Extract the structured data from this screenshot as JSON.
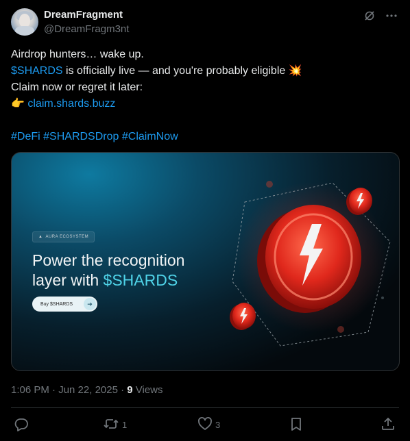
{
  "author": {
    "name": "DreamFragment",
    "handle": "@DreamFragm3nt"
  },
  "icons": {
    "grok": "grok-icon",
    "more": "more-icon",
    "reply": "reply-icon",
    "repost": "repost-icon",
    "like": "like-icon",
    "bookmark": "bookmark-icon",
    "share": "share-icon"
  },
  "post": {
    "line1": "Airdrop hunters… wake up.",
    "line2_cashtag": "$SHARDS",
    "line2_rest": " is officially live — and you're probably eligible ",
    "line2_emoji": "💥",
    "line3": "Claim now or regret it later:",
    "line4_emoji": "👉",
    "link": "claim.shards.buzz",
    "hashtags": [
      "#DeFi",
      "#SHARDSDrop",
      "#ClaimNow"
    ]
  },
  "card": {
    "badge": "AURA ECOSYSTEM",
    "headline_line1": "Power the recognition",
    "headline_line2_prefix": "layer with ",
    "headline_line2_accent": "$SHARDS",
    "button_label": "Buy $SHARDS",
    "colors": {
      "accent": "#4fd3e8",
      "coin_red": "#e0281c"
    }
  },
  "meta": {
    "timestamp": "1:06 PM · Jun 22, 2025 · ",
    "views_count": "9",
    "views_label": " Views"
  },
  "actions": {
    "reply_count": "",
    "repost_count": "1",
    "like_count": "3"
  },
  "colors": {
    "background": "#000000",
    "text": "#e7e9ea",
    "muted": "#71767b",
    "link": "#1d9bf0",
    "divider": "#2f3336"
  }
}
